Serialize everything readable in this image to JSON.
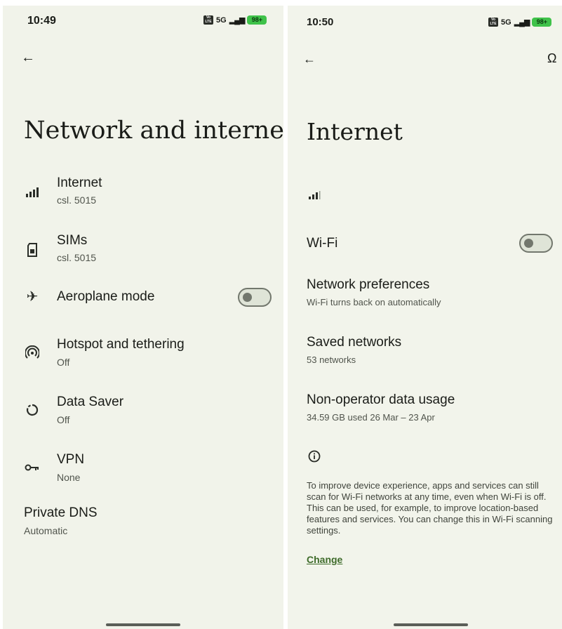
{
  "left": {
    "status": {
      "time": "10:49",
      "network": "5G",
      "battery": "98+"
    },
    "title": "Network and internet",
    "items": [
      {
        "icon": "signal-icon",
        "title": "Internet",
        "subtitle": "csl. 5015"
      },
      {
        "icon": "sim-card-icon",
        "title": "SIMs",
        "subtitle": "csl. 5015"
      },
      {
        "icon": "airplane-icon",
        "title": "Aeroplane mode",
        "toggle": false
      },
      {
        "icon": "hotspot-icon",
        "title": "Hotspot and tethering",
        "subtitle": "Off"
      },
      {
        "icon": "data-saver-icon",
        "title": "Data Saver",
        "subtitle": "Off"
      },
      {
        "icon": "vpn-key-icon",
        "title": "VPN",
        "subtitle": "None"
      },
      {
        "title": "Private DNS",
        "subtitle": "Automatic"
      }
    ]
  },
  "right": {
    "status": {
      "time": "10:50",
      "network": "5G",
      "battery": "98+"
    },
    "title": "Internet",
    "wifi": {
      "title": "Wi-Fi",
      "toggle": false
    },
    "items": [
      {
        "title": "Network preferences",
        "subtitle": "Wi-Fi turns back on automatically"
      },
      {
        "title": "Saved networks",
        "subtitle": "53 networks"
      },
      {
        "title": "Non-operator data usage",
        "subtitle": "34.59 GB used 26 Mar – 23 Apr"
      }
    ],
    "info_text": "To improve device experience, apps and services can still scan for Wi-Fi networks at any time, even when Wi-Fi is off. This can be used, for example, to improve location-based features and services. You can change this in Wi-Fi scanning settings.",
    "change_link": "Change"
  },
  "colors": {
    "background": "#f1f3ea",
    "accent": "#3e6b2a",
    "battery": "#3fc24a"
  }
}
